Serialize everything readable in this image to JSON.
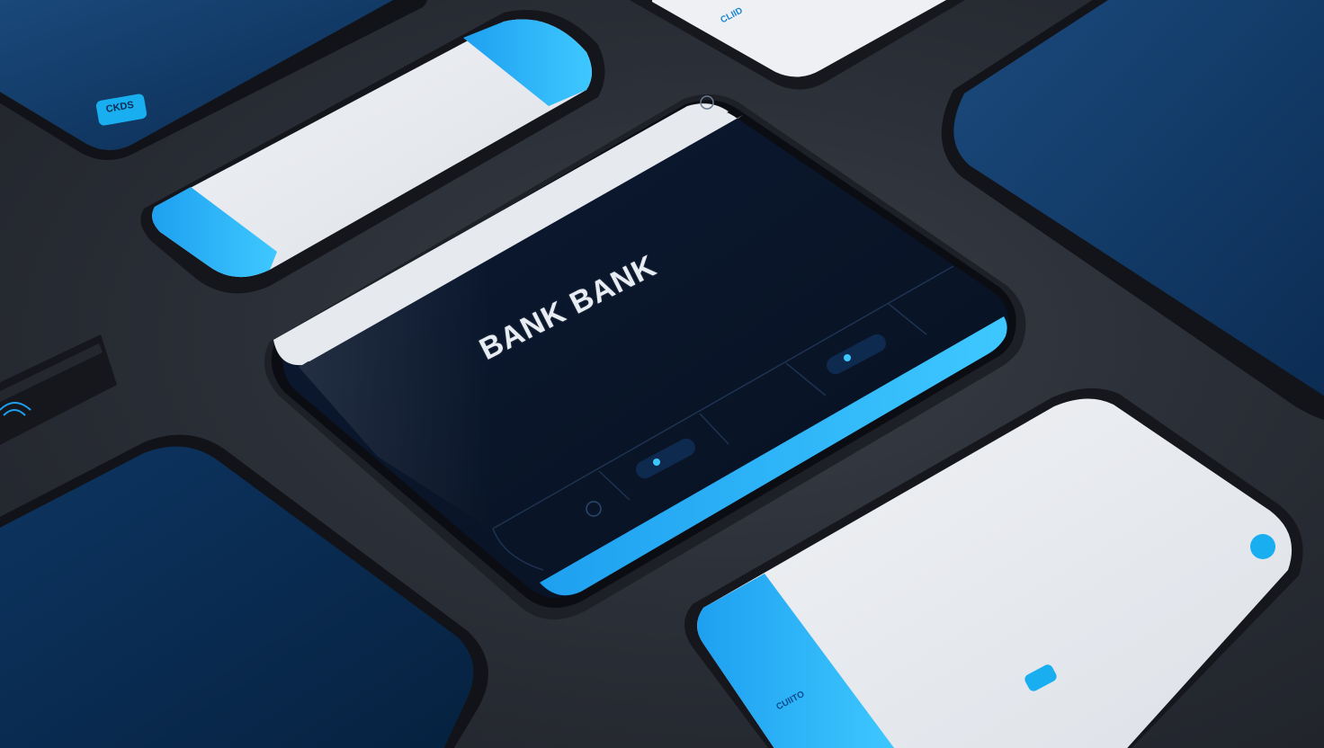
{
  "scene": {
    "main_device": {
      "headline": "BANK BANK"
    },
    "badges": {
      "top_left_phone": "CKDS",
      "top_phone": "CLIID",
      "bottom_right_phone": "CUIITO"
    },
    "colors": {
      "background": "#2a2e36",
      "device_body": "#16181d",
      "screen_dark": "#0a1830",
      "screen_light": "#e6e9ee",
      "accent_cyan": "#18aef0",
      "navy_phone": "#0f3a66"
    }
  }
}
